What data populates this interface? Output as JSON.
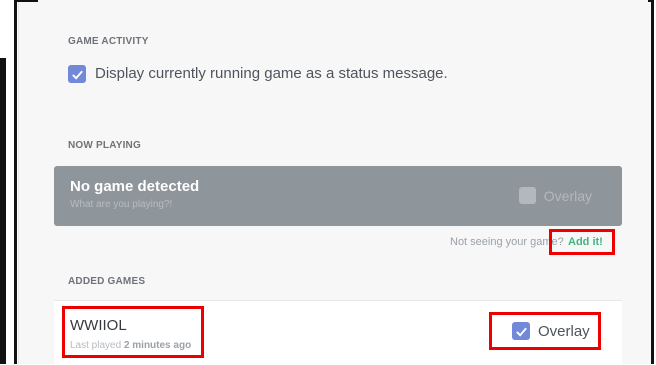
{
  "game_activity": {
    "title": "GAME ACTIVITY",
    "option_label": "Display currently running game as a status message.",
    "option_checked": true
  },
  "now_playing": {
    "title": "NOW PLAYING",
    "status_title": "No game detected",
    "status_sub": "What are you playing?!",
    "overlay_label": "Overlay",
    "not_seeing_text": "Not seeing your game?",
    "add_link": "Add it!"
  },
  "added_games": {
    "title": "ADDED GAMES",
    "games": [
      {
        "name": "WWIIOL",
        "last_played_prefix": "Last played",
        "last_played_value": "2 minutes ago",
        "overlay_label": "Overlay",
        "overlay_checked": true
      }
    ]
  },
  "colors": {
    "accent": "#7289da",
    "link": "#43b581",
    "highlight": "#ee0000"
  },
  "icons": [
    "checkmark-icon"
  ]
}
